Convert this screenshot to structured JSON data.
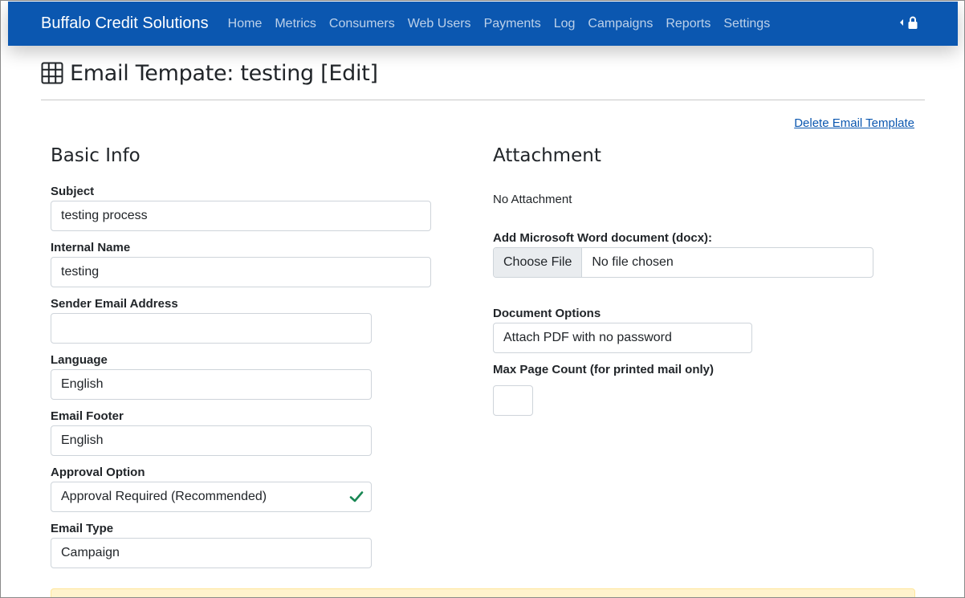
{
  "navbar": {
    "brand": "Buffalo Credit Solutions",
    "links": [
      "Home",
      "Metrics",
      "Consumers",
      "Web Users",
      "Payments",
      "Log",
      "Campaigns",
      "Reports",
      "Settings"
    ],
    "right_icons": [
      "caret-left-icon",
      "lock-icon"
    ]
  },
  "page": {
    "title": "Email Tempate: testing [Edit]",
    "title_icon": "table-grid-icon",
    "delete_link": "Delete Email Template"
  },
  "basic_info": {
    "heading": "Basic Info",
    "subject": {
      "label": "Subject",
      "value": "testing process"
    },
    "internal_name": {
      "label": "Internal Name",
      "value": "testing"
    },
    "sender_email": {
      "label": "Sender Email Address",
      "value": ""
    },
    "language": {
      "label": "Language",
      "value": "English"
    },
    "email_footer": {
      "label": "Email Footer",
      "value": "English"
    },
    "approval_option": {
      "label": "Approval Option",
      "value": "Approval Required (Recommended)",
      "valid_icon": "check-icon"
    },
    "email_type": {
      "label": "Email Type",
      "value": "Campaign"
    }
  },
  "attachment": {
    "heading": "Attachment",
    "status": "No Attachment",
    "docx_label": "Add Microsoft Word document (docx):",
    "choose_file": "Choose File",
    "no_file": "No file chosen",
    "doc_options": {
      "label": "Document Options",
      "value": "Attach PDF with no password"
    },
    "max_page": {
      "label": "Max Page Count (for printed mail only)",
      "value": ""
    }
  },
  "colors": {
    "navbar": "#0b57b0",
    "link": "#0b57b0",
    "valid": "#198754",
    "alert": "#fff3cd"
  }
}
